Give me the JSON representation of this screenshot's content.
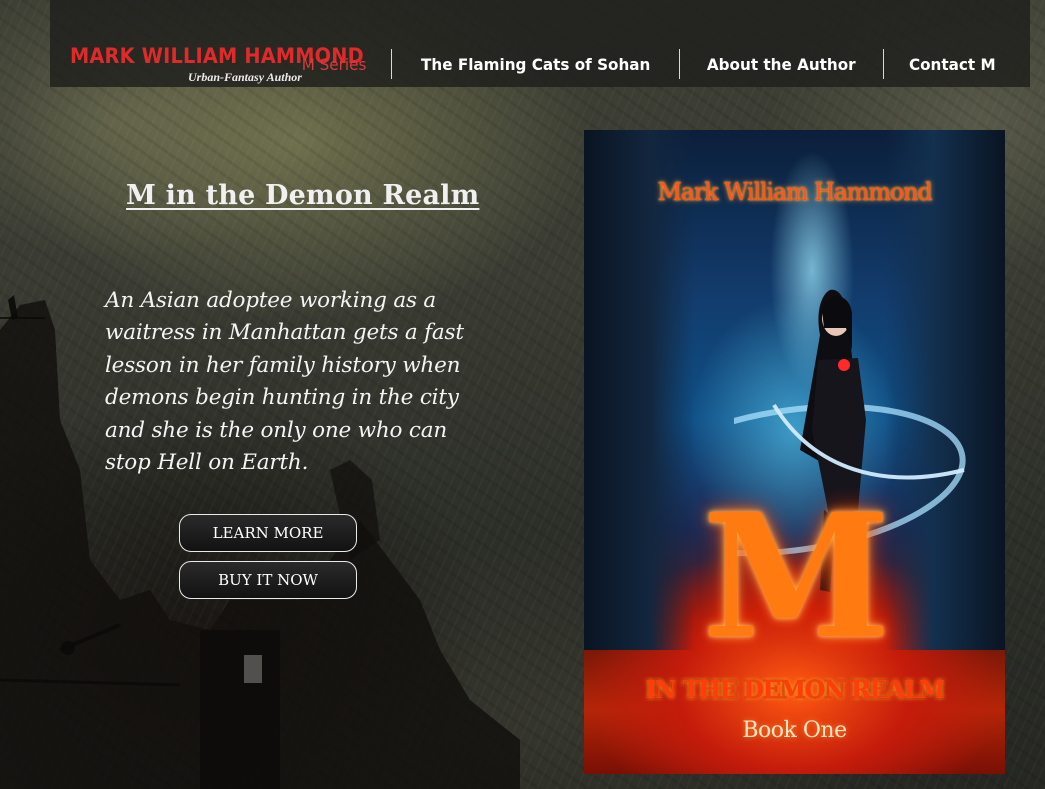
{
  "site": {
    "author_name": "MARK WILLIAM HAMMOND",
    "tagline": "Urban-Fantasy Author"
  },
  "nav": {
    "items": [
      {
        "label": "M Series",
        "active": true
      },
      {
        "label": "The Flaming Cats of Sohan",
        "active": false
      },
      {
        "label": "About the Author",
        "active": false
      },
      {
        "label": "Contact M",
        "active": false
      }
    ]
  },
  "book": {
    "title": "M in the Demon Realm",
    "description": "An Asian adoptee working as a waitress in Manhattan gets a fast lesson in her family history when demons begin hunting in the city and she is the only one who can stop Hell on Earth.",
    "learn_more_label": "LEARN MORE",
    "buy_label": "BUY IT NOW"
  },
  "cover": {
    "author": "Mark William Hammond",
    "big_letter": "M",
    "subtitle": "IN THE DEMON REALM",
    "book_number": "Book One"
  },
  "colors": {
    "accent_red": "#e02a2a",
    "active_nav": "#d93a3a"
  }
}
